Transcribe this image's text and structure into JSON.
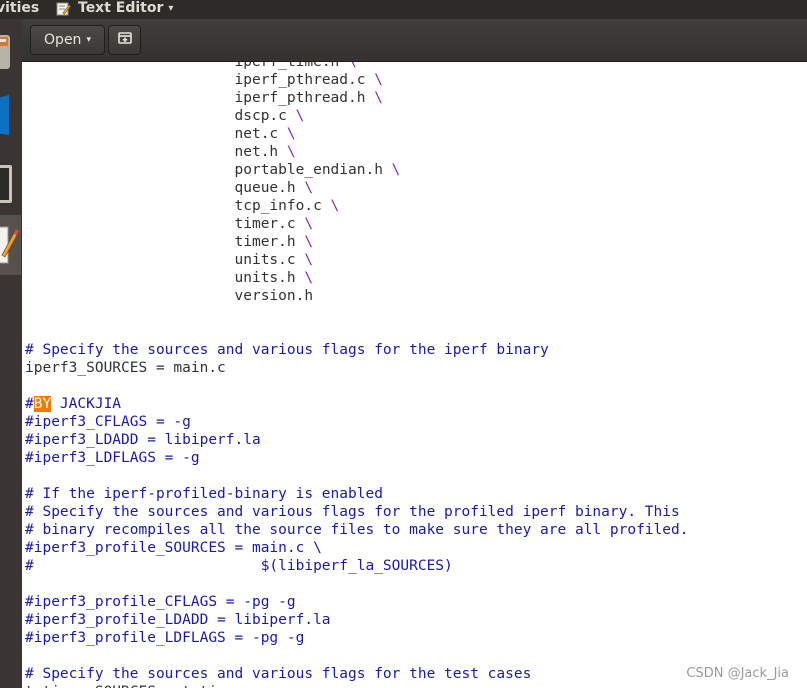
{
  "panel": {
    "activities_label": "vities",
    "app_name": "Text Editor",
    "app_menu_arrow": "▾"
  },
  "header": {
    "open_label": "Open",
    "open_arrow": "▾"
  },
  "editor": {
    "lines": [
      {
        "indent": "                        ",
        "text": "iperf_time.h",
        "cont": " \\",
        "style": "plain"
      },
      {
        "indent": "                        ",
        "text": "iperf_pthread.c",
        "cont": " \\",
        "style": "plain"
      },
      {
        "indent": "                        ",
        "text": "iperf_pthread.h",
        "cont": " \\",
        "style": "plain"
      },
      {
        "indent": "                        ",
        "text": "dscp.c",
        "cont": " \\",
        "style": "plain"
      },
      {
        "indent": "                        ",
        "text": "net.c",
        "cont": " \\",
        "style": "plain"
      },
      {
        "indent": "                        ",
        "text": "net.h",
        "cont": " \\",
        "style": "plain"
      },
      {
        "indent": "                        ",
        "text": "portable_endian.h",
        "cont": " \\",
        "style": "plain"
      },
      {
        "indent": "                        ",
        "text": "queue.h",
        "cont": " \\",
        "style": "plain"
      },
      {
        "indent": "                        ",
        "text": "tcp_info.c",
        "cont": " \\",
        "style": "plain"
      },
      {
        "indent": "                        ",
        "text": "timer.c",
        "cont": " \\",
        "style": "plain"
      },
      {
        "indent": "                        ",
        "text": "timer.h",
        "cont": " \\",
        "style": "plain"
      },
      {
        "indent": "                        ",
        "text": "units.c",
        "cont": " \\",
        "style": "plain"
      },
      {
        "indent": "                        ",
        "text": "units.h",
        "cont": " \\",
        "style": "plain"
      },
      {
        "indent": "                        ",
        "text": "version.h",
        "cont": "",
        "style": "plain"
      },
      {
        "indent": "",
        "text": "",
        "cont": "",
        "style": "plain"
      },
      {
        "indent": "",
        "text": "",
        "cont": "",
        "style": "plain"
      },
      {
        "indent": "",
        "text": "# Specify the sources and various flags for the iperf binary",
        "cont": "",
        "style": "comment"
      },
      {
        "indent": "",
        "text": "iperf3_SOURCES = main.c",
        "cont": "",
        "style": "plain"
      },
      {
        "indent": "",
        "text": "",
        "cont": "",
        "style": "plain"
      },
      {
        "indent": "",
        "text": "#",
        "highlight": "BY",
        "after": " JACKJIA",
        "cont": "",
        "style": "comment"
      },
      {
        "indent": "",
        "text": "#iperf3_CFLAGS = -g",
        "cont": "",
        "style": "comment"
      },
      {
        "indent": "",
        "text": "#iperf3_LDADD = libiperf.la",
        "cont": "",
        "style": "comment"
      },
      {
        "indent": "",
        "text": "#iperf3_LDFLAGS = -g",
        "cont": "",
        "style": "comment"
      },
      {
        "indent": "",
        "text": "",
        "cont": "",
        "style": "plain"
      },
      {
        "indent": "",
        "text": "# If the iperf-profiled-binary is enabled",
        "cont": "",
        "style": "comment"
      },
      {
        "indent": "",
        "text": "# Specify the sources and various flags for the profiled iperf binary. This",
        "cont": "",
        "style": "comment"
      },
      {
        "indent": "",
        "text": "# binary recompiles all the source files to make sure they are all profiled.",
        "cont": "",
        "style": "comment"
      },
      {
        "indent": "",
        "text": "#iperf3_profile_SOURCES = main.c \\",
        "cont": "",
        "style": "comment"
      },
      {
        "indent": "",
        "text": "#                          $(libiperf_la_SOURCES)",
        "cont": "",
        "style": "comment"
      },
      {
        "indent": "",
        "text": "",
        "cont": "",
        "style": "plain"
      },
      {
        "indent": "",
        "text": "#iperf3_profile_CFLAGS = -pg -g",
        "cont": "",
        "style": "comment"
      },
      {
        "indent": "",
        "text": "#iperf3_profile_LDADD = libiperf.la",
        "cont": "",
        "style": "comment"
      },
      {
        "indent": "",
        "text": "#iperf3_profile_LDFLAGS = -pg -g",
        "cont": "",
        "style": "comment"
      },
      {
        "indent": "",
        "text": "",
        "cont": "",
        "style": "plain"
      },
      {
        "indent": "",
        "text": "# Specify the sources and various flags for the test cases",
        "cont": "",
        "style": "comment"
      },
      {
        "indent": "",
        "text": "t_timer_SOURCES = t_timer.c",
        "cont": "",
        "style": "plain"
      }
    ]
  },
  "watermark": "CSDN @Jack_Jia",
  "colors": {
    "comment": "#1a1aa6",
    "continuation": "#8a2ab0",
    "search_highlight": "#f57900",
    "panel_bg": "#2c2b27",
    "launcher_bg": "#3a3432"
  }
}
